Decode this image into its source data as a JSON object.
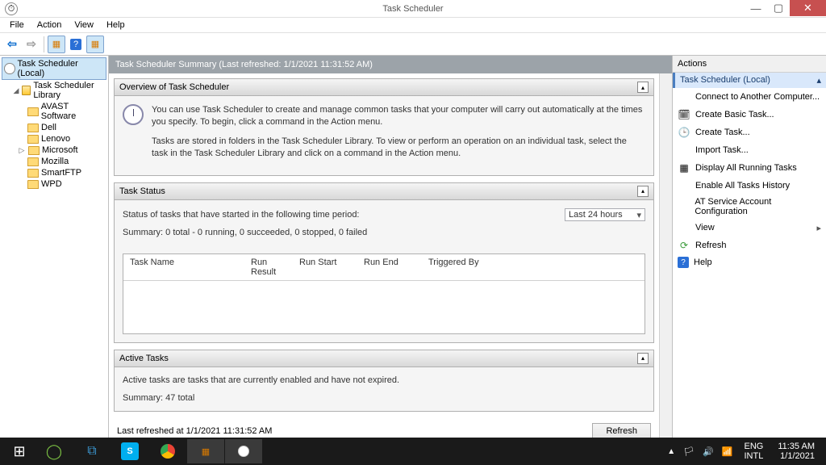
{
  "window": {
    "title": "Task Scheduler"
  },
  "menu": {
    "file": "File",
    "action": "Action",
    "view": "View",
    "help": "Help"
  },
  "tree": {
    "root": "Task Scheduler (Local)",
    "library": "Task Scheduler Library",
    "items": [
      "AVAST Software",
      "Dell",
      "Lenovo",
      "Microsoft",
      "Mozilla",
      "SmartFTP",
      "WPD"
    ]
  },
  "center": {
    "header": "Task Scheduler Summary (Last refreshed: 1/1/2021 11:31:52 AM)",
    "overview": {
      "title": "Overview of Task Scheduler",
      "p1": "You can use Task Scheduler to create and manage common tasks that your computer will carry out automatically at the times you specify. To begin, click a command in the Action menu.",
      "p2": "Tasks are stored in folders in the Task Scheduler Library. To view or perform an operation on an individual task, select the task in the Task Scheduler Library and click on a command in the Action menu."
    },
    "status": {
      "title": "Task Status",
      "label": "Status of tasks that have started in the following time period:",
      "period": "Last 24 hours",
      "summary": "Summary: 0 total - 0 running, 0 succeeded, 0 stopped, 0 failed",
      "cols": {
        "name": "Task Name",
        "result": "Run Result",
        "start": "Run Start",
        "end": "Run End",
        "trigger": "Triggered By"
      }
    },
    "active": {
      "title": "Active Tasks",
      "desc": "Active tasks are tasks that are currently enabled and have not expired.",
      "summary": "Summary: 47 total"
    },
    "footer": {
      "lastRefreshed": "Last refreshed at 1/1/2021 11:31:52 AM",
      "refresh": "Refresh"
    }
  },
  "actions": {
    "title": "Actions",
    "context": "Task Scheduler (Local)",
    "items": {
      "connect": "Connect to Another Computer...",
      "createBasic": "Create Basic Task...",
      "createTask": "Create Task...",
      "import": "Import Task...",
      "displayRunning": "Display All Running Tasks",
      "enableHistory": "Enable All Tasks History",
      "atService": "AT Service Account Configuration",
      "view": "View",
      "refresh": "Refresh",
      "help": "Help"
    }
  },
  "taskbar": {
    "lang1": "ENG",
    "lang2": "INTL",
    "time": "11:35 AM",
    "date": "1/1/2021"
  }
}
